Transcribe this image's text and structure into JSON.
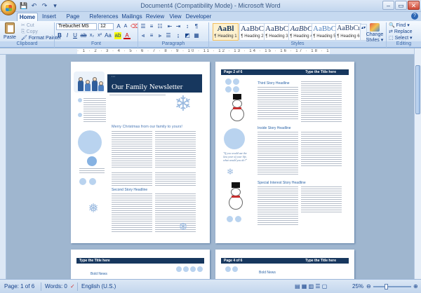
{
  "window": {
    "title": "Document4 (Compatibility Mode) - Microsoft Word",
    "controls": [
      "–",
      "▭",
      "✕"
    ]
  },
  "qat": [
    "💾",
    "↶",
    "↷",
    "▾"
  ],
  "tabs": [
    "Home",
    "Insert",
    "Page Layout",
    "References",
    "Mailings",
    "Review",
    "View",
    "Developer"
  ],
  "clipboard": {
    "paste": "Paste",
    "cut": "Cut",
    "copy": "Copy",
    "format_painter": "Format Painter",
    "label": "Clipboard"
  },
  "font": {
    "name": "Trebuchet MS",
    "size": "12",
    "label": "Font"
  },
  "paragraph": {
    "label": "Paragraph"
  },
  "styles": {
    "label": "Styles",
    "items": [
      {
        "sample": "AaBl",
        "name": "¶ Heading 1"
      },
      {
        "sample": "AaBbC",
        "name": "¶ Heading 2"
      },
      {
        "sample": "AaBbC",
        "name": "¶ Heading 3"
      },
      {
        "sample": "AaBbC",
        "name": "¶ Heading 4"
      },
      {
        "sample": "AaBbC",
        "name": "¶ Heading 5"
      },
      {
        "sample": "AaBbCı",
        "name": "¶ Heading 6"
      }
    ],
    "change": "Change Styles ▾"
  },
  "editing": {
    "find": "Find ▾",
    "replace": "Replace",
    "select": "Select ▾",
    "label": "Editing"
  },
  "doc": {
    "page1": {
      "title": "Our Family Newsletter",
      "greeting": "Merry Christmas from our family to yours!",
      "second_heading": "Second Story Headline",
      "quote": "Special points of interest: Briefly highlight your point of interest here."
    },
    "page2": {
      "band": "Page 2 of 6",
      "band_right": "Type the Title here",
      "h1": "Third Story Headline",
      "h2": "Inside Story Headline",
      "h3": "Special Interest Story Headline",
      "quote": "\"If you would use the last year of your life, what would you do?\""
    },
    "page3": {
      "band": "Type the Title here",
      "h": "Bold News"
    },
    "page4": {
      "band": "Page 4 of 6",
      "band_right": "Type the Title here",
      "h": "Bold News"
    }
  },
  "status": {
    "page": "Page: 1 of 6",
    "words": "Words: 0",
    "language": "English (U.S.)",
    "zoom": "25%"
  }
}
